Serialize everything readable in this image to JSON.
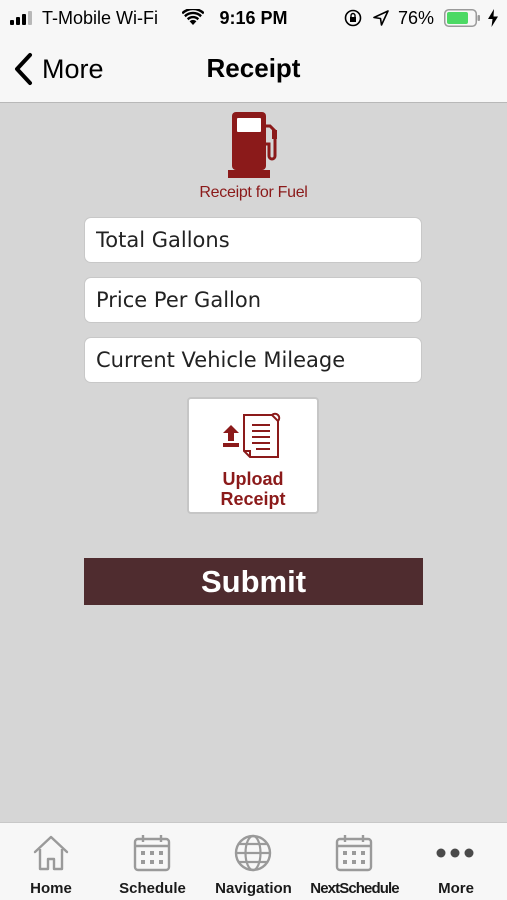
{
  "status_bar": {
    "carrier": "T-Mobile Wi-Fi",
    "time": "9:16 PM",
    "battery": "76%"
  },
  "nav": {
    "back_label": "More",
    "title": "Receipt"
  },
  "header": {
    "icon": "fuel-pump-icon",
    "caption": "Receipt for Fuel"
  },
  "form": {
    "total_gallons_placeholder": "Total Gallons",
    "price_per_gallon_placeholder": "Price Per Gallon",
    "mileage_placeholder": "Current Vehicle Mileage",
    "upload_line1": "Upload",
    "upload_line2": "Receipt",
    "submit_label": "Submit"
  },
  "tabs": [
    {
      "label": "Home",
      "icon": "home-icon"
    },
    {
      "label": "Schedule",
      "icon": "calendar-icon"
    },
    {
      "label": "Navigation",
      "icon": "globe-icon"
    },
    {
      "label": "NextSchedule",
      "icon": "calendar-icon"
    },
    {
      "label": "More",
      "icon": "more-dots-icon"
    }
  ],
  "colors": {
    "brand": "#8b1a1a",
    "submit_bg": "#4f2c2f",
    "background": "#d6d6d6",
    "battery_fill": "#4cd964"
  }
}
